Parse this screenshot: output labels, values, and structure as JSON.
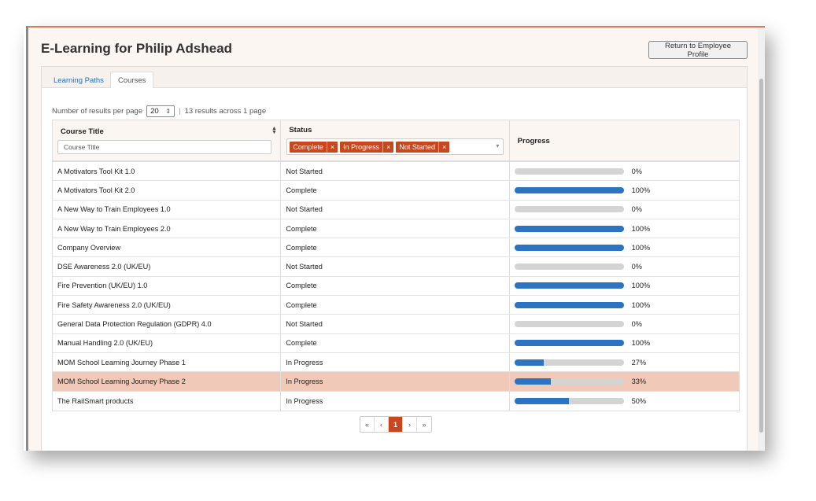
{
  "page": {
    "title": "E-Learning for Philip Adshead",
    "return_button": "Return to Employee Profile"
  },
  "tabs": [
    {
      "label": "Learning Paths",
      "active": false
    },
    {
      "label": "Courses",
      "active": true
    }
  ],
  "results": {
    "per_page_label": "Number of results per page",
    "per_page_value": "20",
    "per_page_caret": "⇕",
    "separator": "|",
    "summary": "13 results across 1 page"
  },
  "grid": {
    "columns": {
      "title": "Course Title",
      "status": "Status",
      "progress": "Progress"
    },
    "title_filter_placeholder": "Course Title",
    "status_filter_chips": [
      "Complete",
      "In Progress",
      "Not Started"
    ],
    "chip_remove_glyph": "×",
    "status_caret": "▾",
    "sort_icon": "sort-arrows-icon",
    "rows": [
      {
        "title": "A Motivators Tool Kit 1.0",
        "status": "Not Started",
        "progress": 0,
        "progress_label": "0%"
      },
      {
        "title": "A Motivators Tool Kit 2.0",
        "status": "Complete",
        "progress": 100,
        "progress_label": "100%"
      },
      {
        "title": "A New Way to Train Employees 1.0",
        "status": "Not Started",
        "progress": 0,
        "progress_label": "0%"
      },
      {
        "title": "A New Way to Train Employees 2.0",
        "status": "Complete",
        "progress": 100,
        "progress_label": "100%"
      },
      {
        "title": "Company Overview",
        "status": "Complete",
        "progress": 100,
        "progress_label": "100%"
      },
      {
        "title": "DSE Awareness 2.0 (UK/EU)",
        "status": "Not Started",
        "progress": 0,
        "progress_label": "0%"
      },
      {
        "title": "Fire Prevention (UK/EU) 1.0",
        "status": "Complete",
        "progress": 100,
        "progress_label": "100%"
      },
      {
        "title": "Fire Safety Awareness 2.0 (UK/EU)",
        "status": "Complete",
        "progress": 100,
        "progress_label": "100%"
      },
      {
        "title": "General Data Protection Regulation (GDPR) 4.0",
        "status": "Not Started",
        "progress": 0,
        "progress_label": "0%"
      },
      {
        "title": "Manual Handling 2.0 (UK/EU)",
        "status": "Complete",
        "progress": 100,
        "progress_label": "100%"
      },
      {
        "title": "MOM School Learning Journey Phase 1",
        "status": "In Progress",
        "progress": 27,
        "progress_label": "27%"
      },
      {
        "title": "MOM School Learning Journey Phase 2",
        "status": "In Progress",
        "progress": 33,
        "progress_label": "33%",
        "highlighted": true
      },
      {
        "title": "The RailSmart products",
        "status": "In Progress",
        "progress": 50,
        "progress_label": "50%"
      }
    ]
  },
  "pagination": {
    "first": "«",
    "prev": "‹",
    "current": "1",
    "next": "›",
    "last": "»"
  },
  "colors": {
    "accent": "#c9471f",
    "progress_fill": "#2a74c3",
    "progress_track": "#d4d4d4",
    "highlight_row": "#f0c9b8",
    "link": "#2a6fb8"
  }
}
